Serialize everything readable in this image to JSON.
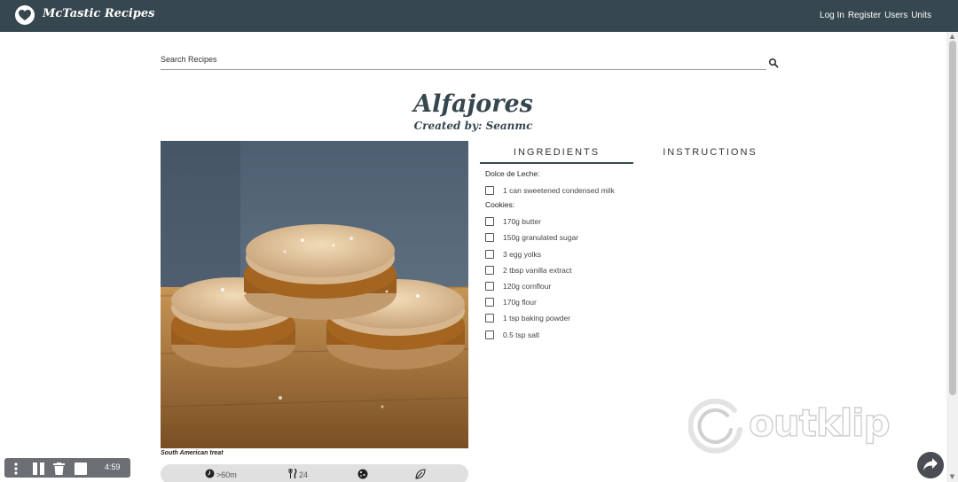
{
  "navbar": {
    "brand": "McTastic Recipes",
    "links": [
      "Log In",
      "Register",
      "Users",
      "Units"
    ],
    "background": "#37474f"
  },
  "search": {
    "placeholder": "Search Recipes",
    "icon": "search-icon"
  },
  "recipe": {
    "title": "Alfajores",
    "author": "Created by: Seanmc",
    "photo_caption": "South American treat",
    "stats": {
      "time": ">60m",
      "servings": "24",
      "category_icon": "cookie-icon",
      "diet_icon": "leaf-icon"
    }
  },
  "tabs": [
    {
      "label": "INGREDIENTS",
      "active": true
    },
    {
      "label": "INSTRUCTIONS",
      "active": false
    }
  ],
  "ingredients": {
    "group1": {
      "heading": "Dolce de Leche:",
      "items": [
        "1 can sweetened condensed milk"
      ]
    },
    "group2": {
      "heading": "Cookies:",
      "items": [
        "170g butter",
        "150g granulated sugar",
        "3 egg yolks",
        "2 tbsp vanilla extract",
        "120g cornflour",
        "170g flour",
        "1 tsp baking powder",
        "0.5 tsp salt"
      ]
    }
  },
  "watermark": {
    "text": "outklip"
  },
  "recorder": {
    "time": "4:59",
    "icons": [
      "more-icon",
      "pause-icon",
      "trash-icon",
      "stop-icon"
    ]
  },
  "share": {
    "icon": "share-icon"
  }
}
